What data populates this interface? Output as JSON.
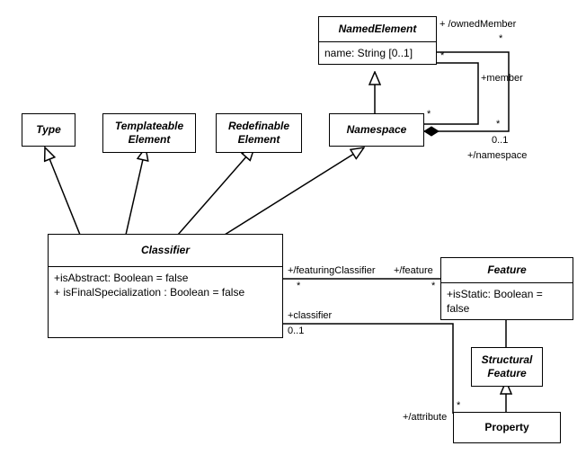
{
  "classes": {
    "named_element": {
      "name": "NamedElement",
      "attr": "name: String [0..1]"
    },
    "type": {
      "name": "Type"
    },
    "templateable": {
      "name": "Templateable\nElement"
    },
    "redefinable": {
      "name": "Redefinable\nElement"
    },
    "namespace": {
      "name": "Namespace"
    },
    "classifier": {
      "name": "Classifier",
      "attrs": [
        "+isAbstract: Boolean = false",
        "+ isFinalSpecialization : Boolean = false"
      ]
    },
    "feature": {
      "name": "Feature",
      "attr": "+isStatic: Boolean = false"
    },
    "structural": {
      "name": "Structural\nFeature"
    },
    "property": {
      "name": "Property"
    }
  },
  "labels": {
    "ownedMember": "+ /ownedMember",
    "member": "+member",
    "namespace_end": "+/namespace",
    "featuringClassifier": "+/featuringClassifier",
    "feature": "+/feature",
    "classifier": "+classifier",
    "attribute": "+/attribute",
    "star": "*",
    "zero_one": "0..1"
  }
}
